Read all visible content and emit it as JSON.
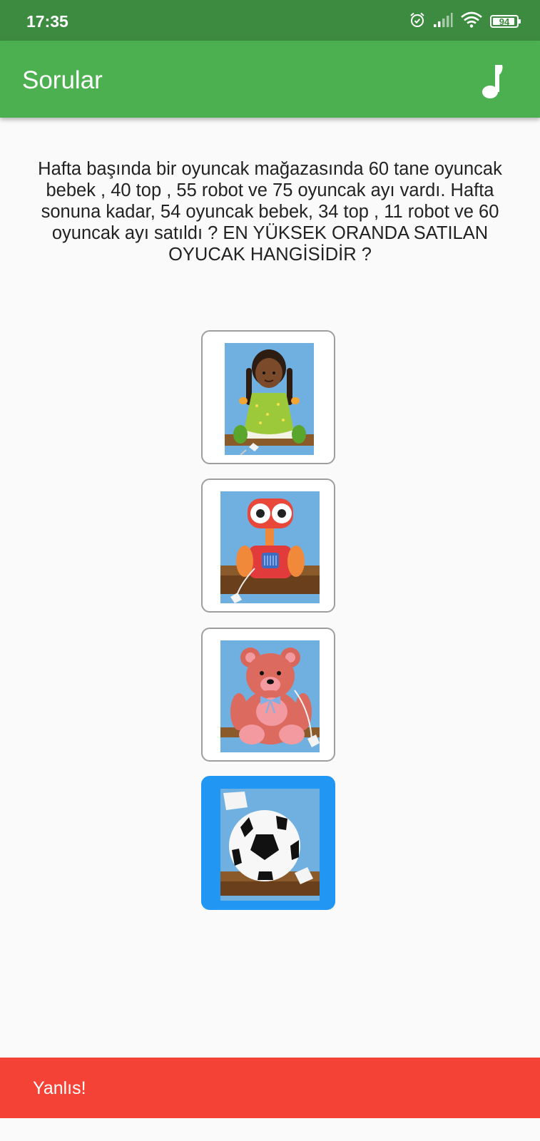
{
  "status_bar": {
    "time": "17:35",
    "battery": "94",
    "battery_level_percent": 94,
    "icons": [
      "alarm-icon",
      "signal-icon",
      "wifi-icon",
      "battery-icon"
    ]
  },
  "app_bar": {
    "title": "Sorular",
    "action_icon": "music-note-icon"
  },
  "question": {
    "text": "Hafta başında bir oyuncak mağazasında 60 tane oyuncak bebek , 40 top , 55 robot ve 75 oyuncak ayı vardı. Hafta sonuna kadar, 54 oyuncak bebek, 34 top , 11 robot ve 60 oyuncak ayı satıldı ? EN YÜKSEK ORANDA SATILAN OYUCAK HANGİSİDİR ?"
  },
  "options": [
    {
      "id": "doll",
      "image": "doll-image",
      "selected": false
    },
    {
      "id": "robot",
      "image": "robot-image",
      "selected": false
    },
    {
      "id": "teddy-bear",
      "image": "teddy-bear-image",
      "selected": false
    },
    {
      "id": "ball",
      "image": "soccer-ball-image",
      "selected": true
    }
  ],
  "snackbar": {
    "message": "Yanlıs!"
  },
  "colors": {
    "status_bar": "#3d8b40",
    "app_bar": "#4caf50",
    "selected_option": "#2196f3",
    "snackbar": "#f44336"
  }
}
